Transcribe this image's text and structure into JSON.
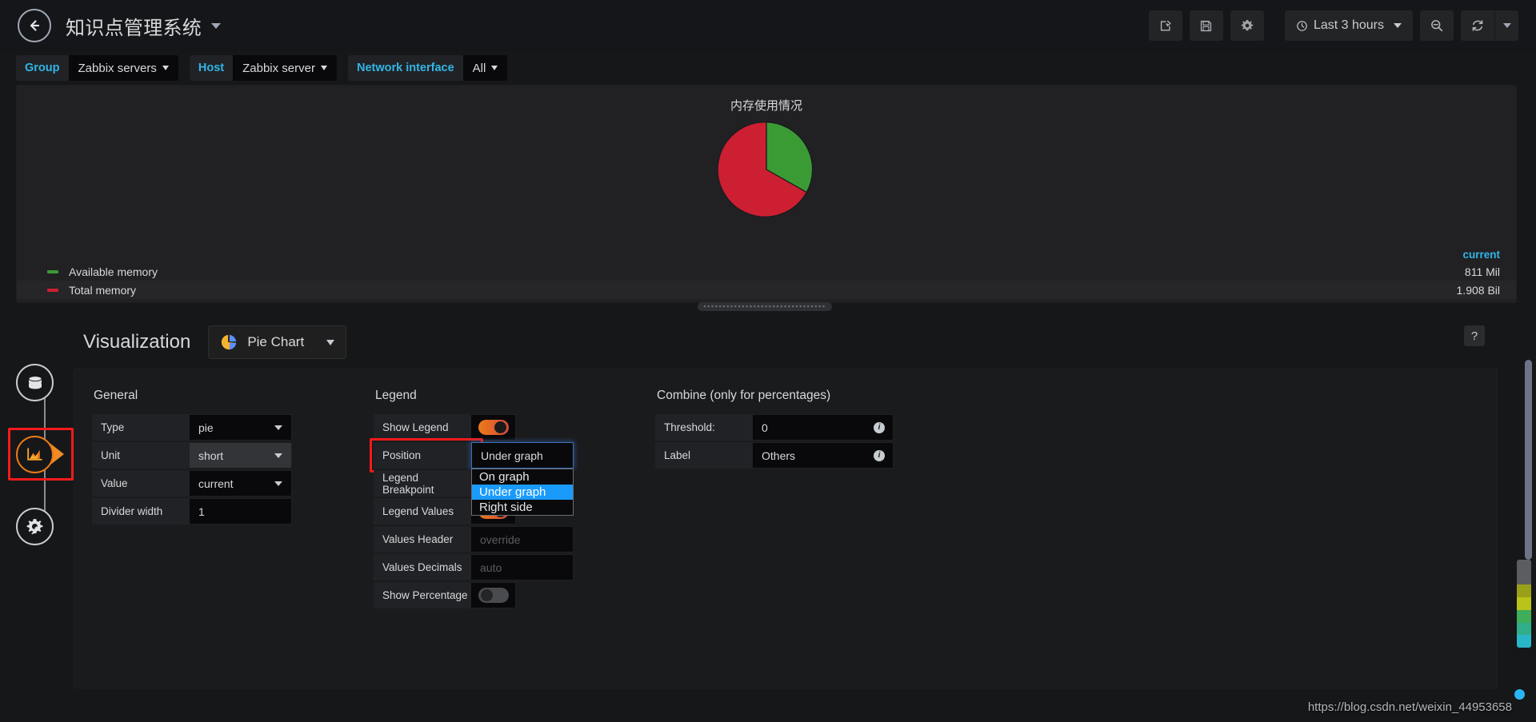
{
  "navbar": {
    "back_icon": "arrow-left-icon",
    "dashboard_title": "知识点管理系统",
    "title_caret_icon": "chevron-down-icon",
    "actions": [
      {
        "name": "share-dashboard-button",
        "icon": "share-icon"
      },
      {
        "name": "save-dashboard-button",
        "icon": "save-icon"
      },
      {
        "name": "dashboard-settings-button",
        "icon": "gear-icon"
      }
    ],
    "time_picker": {
      "clock_icon": "clock-icon",
      "label": "Last 3 hours",
      "caret_icon": "chevron-down-icon"
    },
    "zoom_out_button": {
      "icon": "zoom-out-icon"
    },
    "refresh_button": {
      "icon": "refresh-icon"
    },
    "refresh_interval_caret": {
      "icon": "chevron-down-icon"
    }
  },
  "variables": [
    {
      "label": "Group",
      "value": "Zabbix servers"
    },
    {
      "label": "Host",
      "value": "Zabbix server"
    },
    {
      "label": "Network interface",
      "value": "All"
    }
  ],
  "panel": {
    "title": "内存使用情况",
    "values_header": "current",
    "drag_handle_glyph": "▪▪▪▪▪▪▪▪▪▪▪▪▪▪▪▪▪▪▪▪▪▪▪▪▪▪▪▪▪▪▪▪"
  },
  "chart_data": {
    "type": "pie",
    "title": "内存使用情况",
    "labels": [
      "Available memory",
      "Total memory"
    ],
    "values": [
      811,
      1908
    ],
    "value_labels": [
      "811 Mil",
      "1.908 Bil"
    ],
    "colors": [
      "#3a9b35",
      "#cc1f32"
    ],
    "slice_percent": [
      28,
      72
    ],
    "legend_position": "Under graph",
    "legend_header": "current",
    "unit": "short",
    "value_stat": "current"
  },
  "editor": {
    "heading": "Visualization",
    "viz_picker": {
      "label": "Pie Chart",
      "icon": "pie-chart-icon",
      "caret_icon": "chevron-down-icon"
    },
    "help_label": "?",
    "sections": {
      "general": {
        "title": "General",
        "rows": [
          {
            "label": "Type",
            "value": "pie",
            "control": "select"
          },
          {
            "label": "Unit",
            "value": "short",
            "control": "select",
            "state": "hovered"
          },
          {
            "label": "Value",
            "value": "current",
            "control": "select"
          },
          {
            "label": "Divider width",
            "value": "1",
            "control": "input"
          }
        ]
      },
      "legend": {
        "title": "Legend",
        "rows": [
          {
            "label": "Show Legend",
            "control": "toggle",
            "on": true
          },
          {
            "label": "Position",
            "value": "Under graph",
            "control": "select",
            "highlighted": true,
            "open": true
          },
          {
            "label": "Legend Breakpoint",
            "control": "input",
            "value": ""
          },
          {
            "label": "Legend Values",
            "control": "toggle",
            "on": true
          },
          {
            "label": "Values Header",
            "control": "input",
            "value": "",
            "placeholder": "override"
          },
          {
            "label": "Values Decimals",
            "control": "input",
            "value": "",
            "placeholder": "auto"
          },
          {
            "label": "Show Percentage",
            "control": "toggle",
            "on": false
          }
        ],
        "position_options": [
          "On graph",
          "Under graph",
          "Right side"
        ],
        "position_selected": "Under graph"
      },
      "combine": {
        "title": "Combine (only for percentages)",
        "rows": [
          {
            "label": "Threshold:",
            "value": "0",
            "control": "input",
            "info": true
          },
          {
            "label": "Label",
            "value": "Others",
            "control": "input",
            "info": true
          }
        ]
      }
    }
  },
  "rail": {
    "tabs": [
      {
        "name": "queries-tab",
        "icon": "database-icon",
        "active": false
      },
      {
        "name": "visualization-tab",
        "icon": "graph-icon",
        "active": true
      },
      {
        "name": "general-settings-tab",
        "icon": "gear-wrench-icon",
        "active": false
      }
    ]
  },
  "watermark": "https://blog.csdn.net/weixin_44953658"
}
